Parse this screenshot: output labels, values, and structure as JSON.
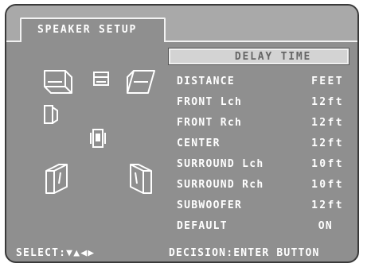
{
  "tab_label": "SPEAKER SETUP",
  "delay_button": "DELAY TIME",
  "settings": [
    {
      "label": "DISTANCE",
      "value": "FEET"
    },
    {
      "label": "FRONT Lch",
      "value": "12ft"
    },
    {
      "label": "FRONT Rch",
      "value": "12ft"
    },
    {
      "label": "CENTER",
      "value": "12ft"
    },
    {
      "label": "SURROUND Lch",
      "value": "10ft"
    },
    {
      "label": "SURROUND Rch",
      "value": "10ft"
    },
    {
      "label": "SUBWOOFER",
      "value": "12ft"
    },
    {
      "label": "DEFAULT",
      "value": "ON"
    }
  ],
  "footer": {
    "select": "SELECT:▼▲◀▶",
    "decision": "DECISION:ENTER BUTTON"
  },
  "icons": {
    "front_left": "front-left-speaker-icon",
    "center": "center-speaker-icon",
    "front_right": "front-right-speaker-icon",
    "side_left": "side-speaker-icon",
    "subwoofer": "subwoofer-icon",
    "surround_left": "surround-left-speaker-icon",
    "surround_right": "surround-right-speaker-icon"
  }
}
